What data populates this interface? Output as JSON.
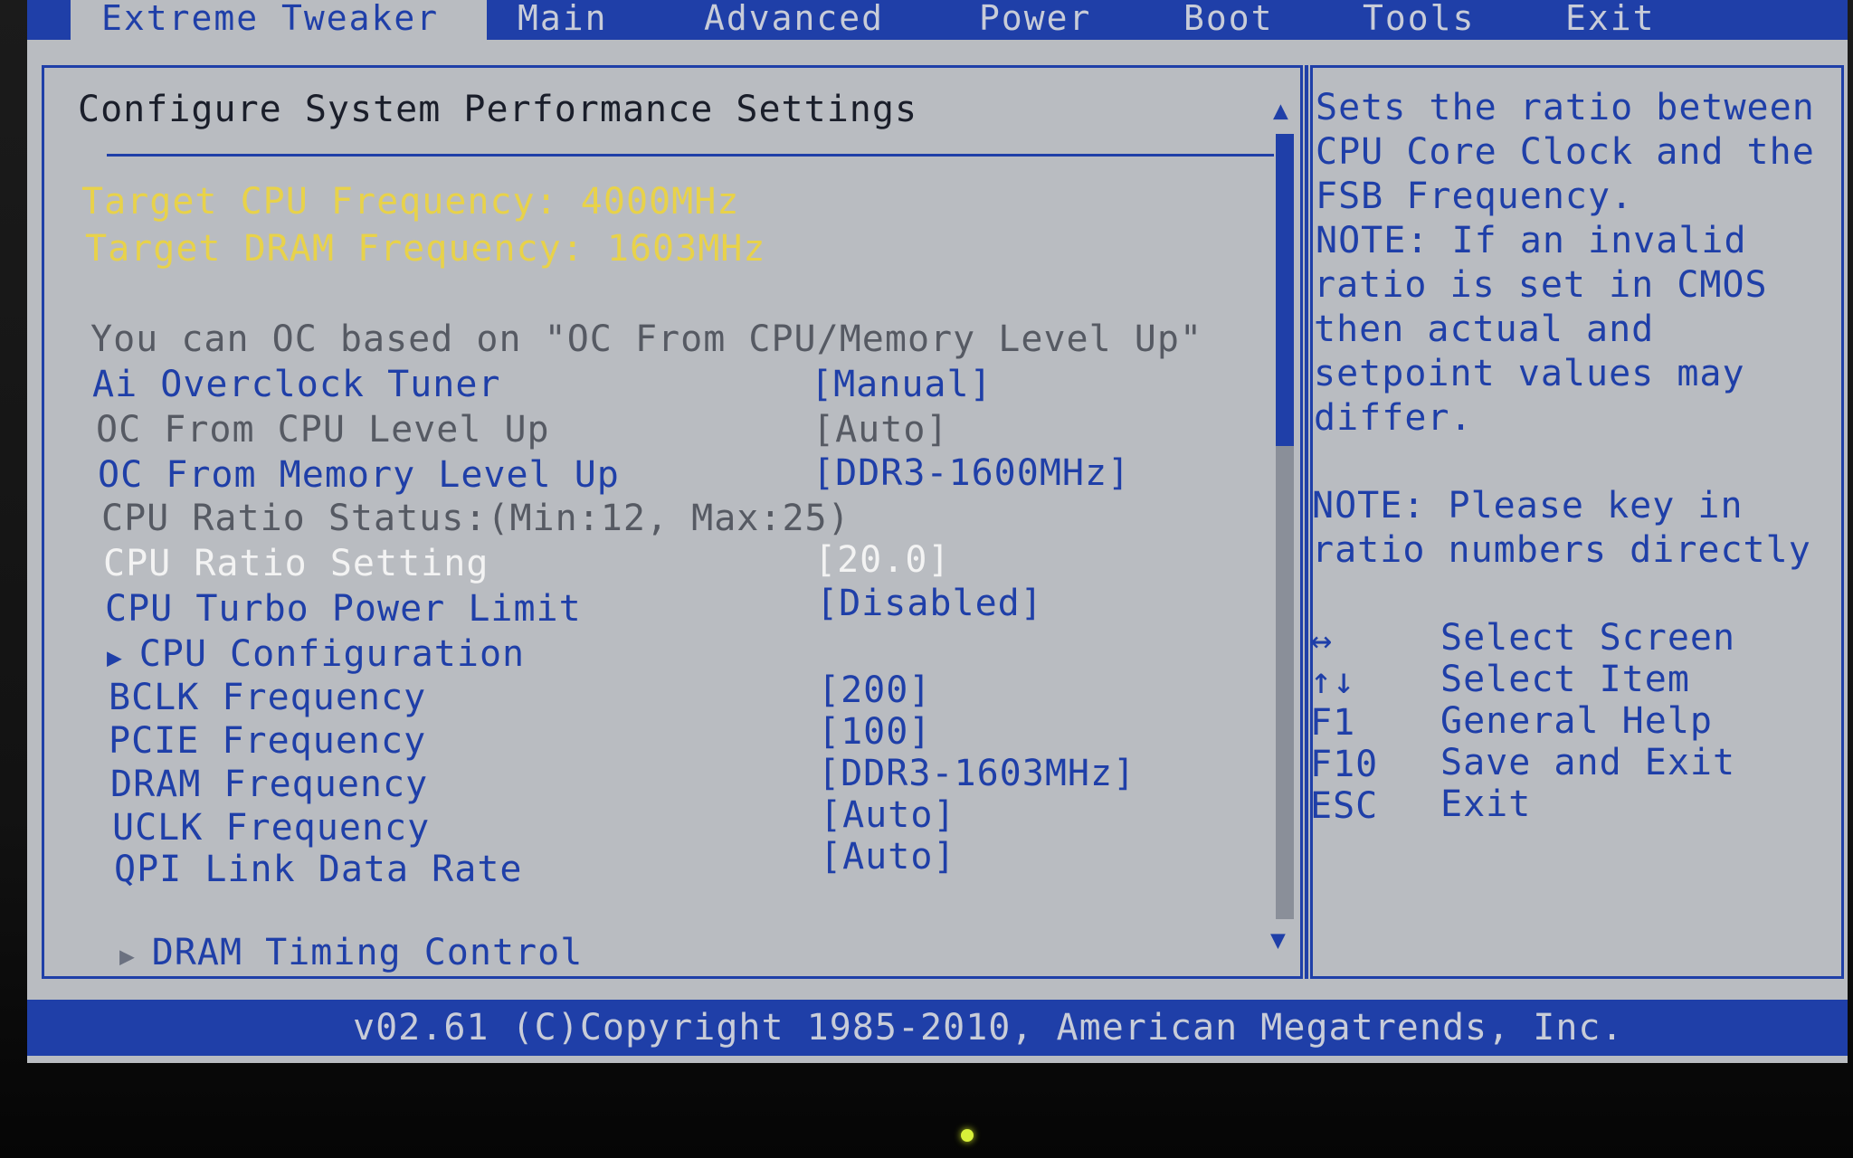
{
  "menu": {
    "tabs": [
      {
        "label": "Extreme Tweaker"
      },
      {
        "label": "Main"
      },
      {
        "label": "Advanced"
      },
      {
        "label": "Power"
      },
      {
        "label": "Boot"
      },
      {
        "label": "Tools"
      },
      {
        "label": "Exit"
      }
    ]
  },
  "panel": {
    "title": "Configure System Performance Settings",
    "target_cpu": "Target CPU Frequency: 4000MHz",
    "target_dram": "Target DRAM Frequency: 1603MHz",
    "oc_note": "You can OC based on \"OC From CPU/Memory Level Up\"",
    "settings": [
      {
        "label": "Ai Overclock Tuner",
        "value": "[Manual]"
      },
      {
        "label": "OC From CPU Level Up",
        "value": "[Auto]"
      },
      {
        "label": "OC From Memory Level Up",
        "value": "[DDR3-1600MHz]"
      },
      {
        "label": "CPU Ratio Status:(Min:12, Max:25)",
        "value": ""
      },
      {
        "label": "CPU Ratio Setting",
        "value": "[20.0]"
      },
      {
        "label": "CPU Turbo Power Limit",
        "value": "[Disabled]"
      },
      {
        "label": "CPU Configuration",
        "value": ""
      },
      {
        "label": "BCLK Frequency",
        "value": "[200]"
      },
      {
        "label": "PCIE Frequency",
        "value": "[100]"
      },
      {
        "label": "DRAM Frequency",
        "value": "[DDR3-1603MHz]"
      },
      {
        "label": "UCLK Frequency",
        "value": "[Auto]"
      },
      {
        "label": "QPI Link Data Rate",
        "value": "[Auto]"
      },
      {
        "label": "DRAM Timing Control",
        "value": ""
      }
    ]
  },
  "help": {
    "lines": [
      "Sets the ratio between",
      "CPU Core Clock and the",
      "FSB Frequency.",
      "NOTE: If an invalid",
      "ratio is set in CMOS",
      "then actual and",
      "setpoint values may",
      "differ.",
      "NOTE: Please key in",
      "ratio numbers directly"
    ],
    "keys": [
      {
        "key": "↔",
        "desc": "Select Screen"
      },
      {
        "key": "↑↓",
        "desc": "Select Item"
      },
      {
        "key": "F1",
        "desc": "General Help"
      },
      {
        "key": "F10",
        "desc": "Save and Exit"
      },
      {
        "key": "ESC",
        "desc": "Exit"
      }
    ]
  },
  "footer": {
    "copyright": "v02.61 (C)Copyright 1985-2010, American Megatrends, Inc."
  },
  "colors": {
    "bios_blue": "#1f3fa8",
    "background": "#b9bcc1",
    "highlight_yellow": "#e8d24a",
    "selected_white": "#f3f3f3",
    "disabled_grey": "#565a63"
  }
}
